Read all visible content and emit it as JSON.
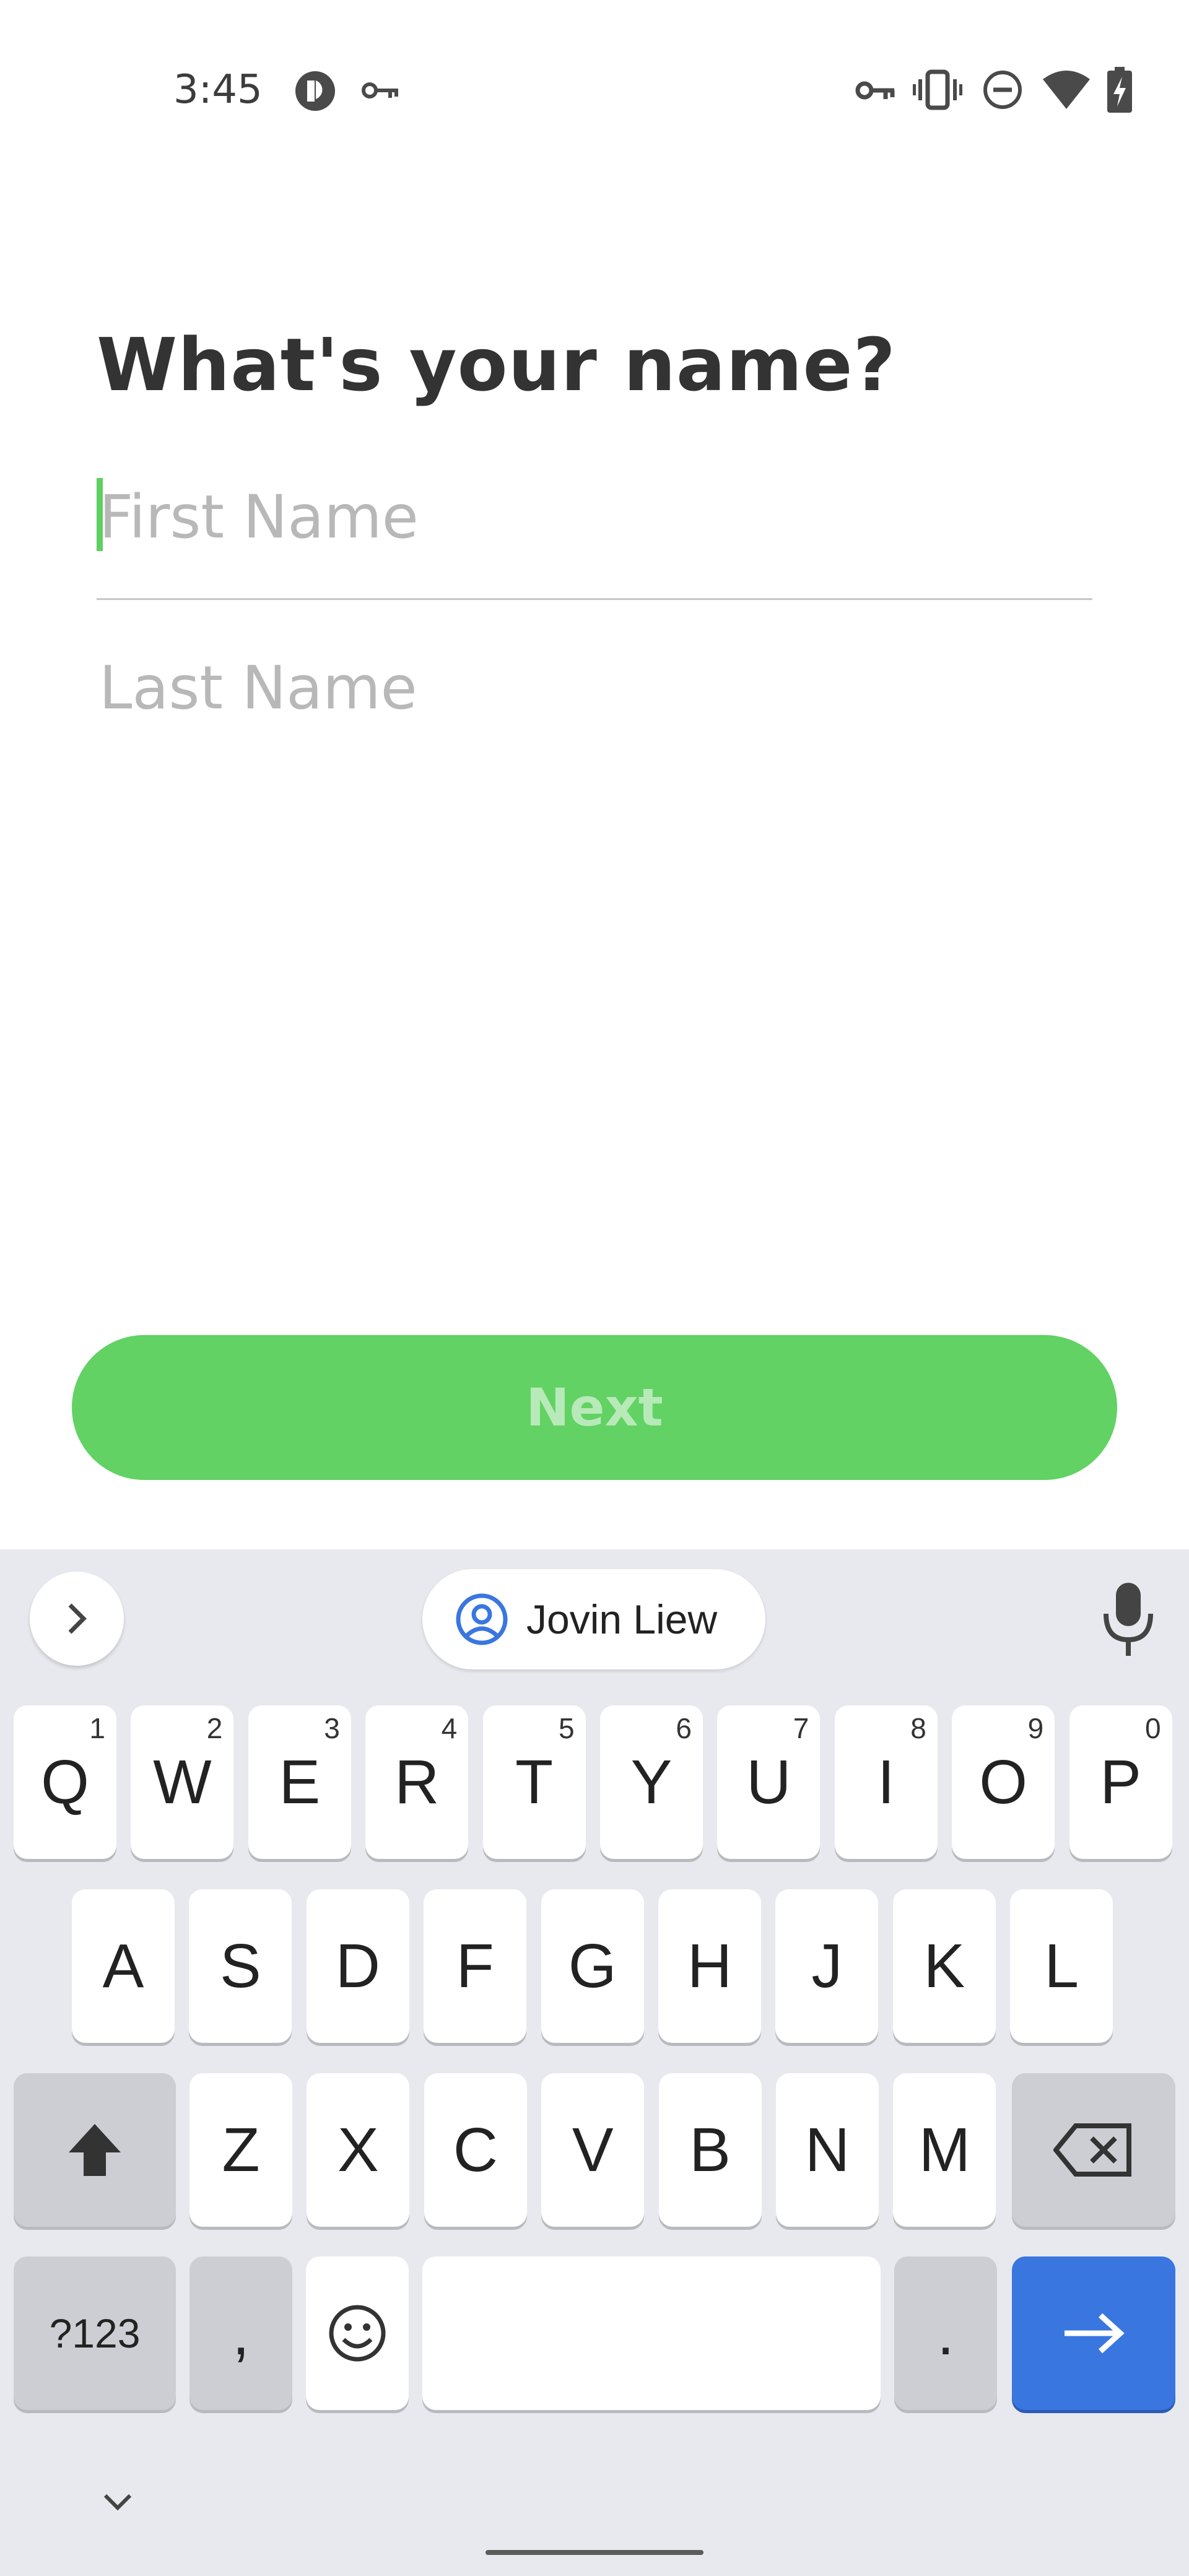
{
  "status_bar": {
    "time": "3:45",
    "left_icons": [
      "app-badge-icon",
      "vpn-key-icon"
    ],
    "right_icons": [
      "vpn-key-icon",
      "vibrate-icon",
      "do-not-disturb-icon",
      "wifi-icon",
      "battery-charging-icon"
    ]
  },
  "form": {
    "heading": "What's your name?",
    "first_name_placeholder": "First Name",
    "first_name_value": "",
    "last_name_placeholder": "Last Name",
    "last_name_value": "",
    "next_label": "Next",
    "accent_color": "#61d263"
  },
  "keyboard": {
    "suggestion": "Jovin Liew",
    "row1": [
      {
        "key": "Q",
        "hint": "1"
      },
      {
        "key": "W",
        "hint": "2"
      },
      {
        "key": "E",
        "hint": "3"
      },
      {
        "key": "R",
        "hint": "4"
      },
      {
        "key": "T",
        "hint": "5"
      },
      {
        "key": "Y",
        "hint": "6"
      },
      {
        "key": "U",
        "hint": "7"
      },
      {
        "key": "I",
        "hint": "8"
      },
      {
        "key": "O",
        "hint": "9"
      },
      {
        "key": "P",
        "hint": "0"
      }
    ],
    "row2": [
      "A",
      "S",
      "D",
      "F",
      "G",
      "H",
      "J",
      "K",
      "L"
    ],
    "row3": [
      "Z",
      "X",
      "C",
      "V",
      "B",
      "N",
      "M"
    ],
    "symbols_label": "?123",
    "comma_label": ",",
    "period_label": ".",
    "enter_color": "#3a76e0"
  }
}
